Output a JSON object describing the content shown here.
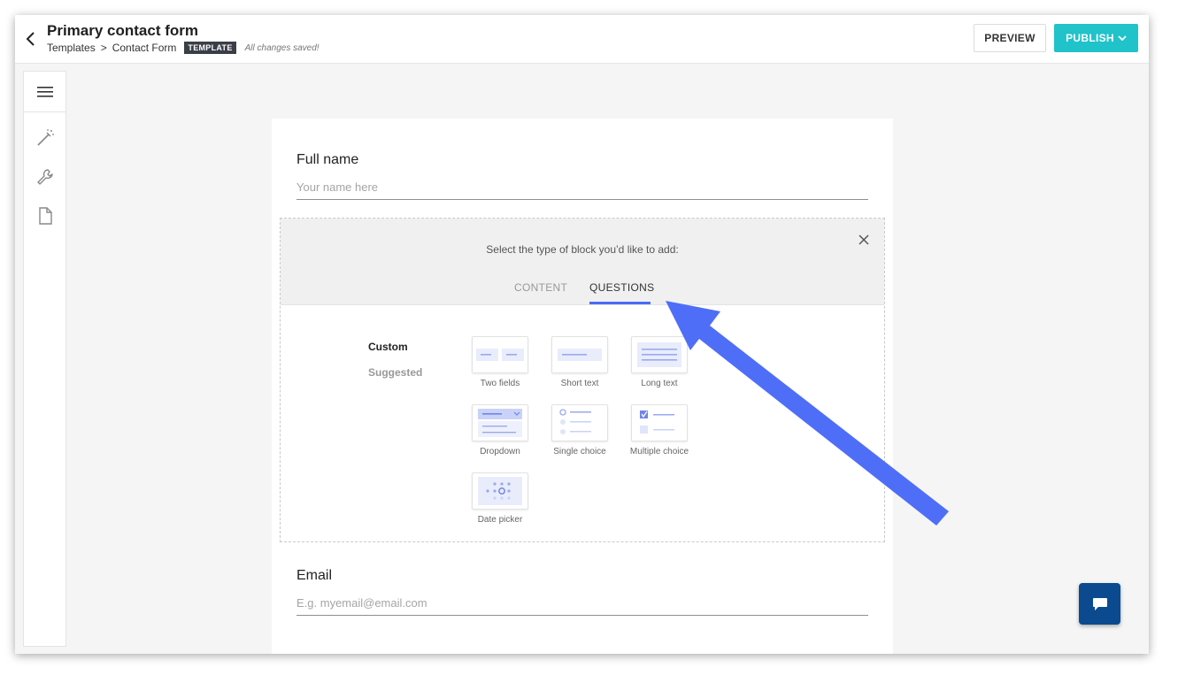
{
  "header": {
    "title": "Primary contact form",
    "breadcrumb_root": "Templates",
    "breadcrumb_sep": ">",
    "breadcrumb_current": "Contact Form",
    "badge": "TEMPLATE",
    "status": "All changes saved!",
    "preview_label": "PREVIEW",
    "publish_label": "PUBLISH"
  },
  "sidebar": {
    "icons": [
      "menu-icon",
      "magic-wand-icon",
      "wrench-icon",
      "page-icon"
    ]
  },
  "form": {
    "full_name_label": "Full name",
    "full_name_placeholder": "Your name here",
    "email_label": "Email",
    "email_placeholder": "E.g. myemail@email.com"
  },
  "block_picker": {
    "prompt": "Select the type of block you’d like to add:",
    "tabs": [
      "CONTENT",
      "QUESTIONS"
    ],
    "active_tab": "QUESTIONS",
    "categories": [
      "Custom",
      "Suggested"
    ],
    "blocks": [
      "Two fields",
      "Short text",
      "Long text",
      "Dropdown",
      "Single choice",
      "Multiple choice",
      "Date picker"
    ]
  },
  "colors": {
    "accent": "#4a6cf7",
    "publish": "#1fc3c9",
    "chat": "#0b4a8f",
    "annotation_arrow": "#4f6ef7"
  }
}
